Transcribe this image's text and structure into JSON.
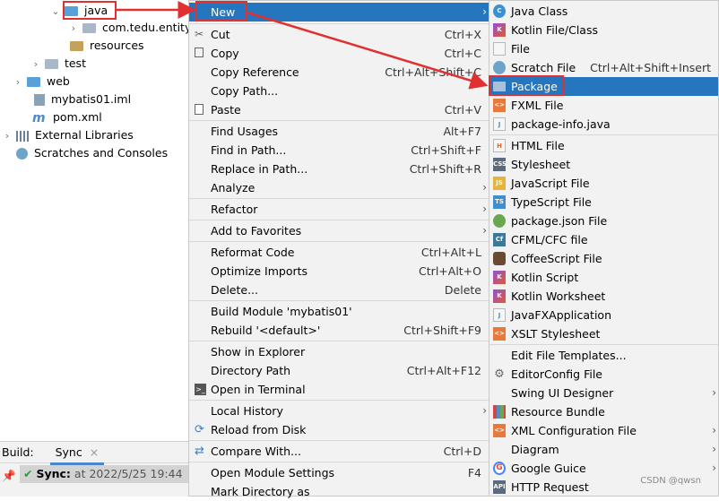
{
  "tree": {
    "java": "java",
    "entity": "com.tedu.entity",
    "resources": "resources",
    "test": "test",
    "web": "web",
    "iml": "mybatis01.iml",
    "pom": "pom.xml",
    "ext_libs": "External Libraries",
    "scratches": "Scratches and Consoles"
  },
  "bottom": {
    "build_label": "Build:",
    "sync_tab": "Sync",
    "sync_title": "Sync:",
    "sync_time": "at 2022/5/25 19:44"
  },
  "context_menu": {
    "new": "New",
    "cut": "Cut",
    "cut_sc": "Ctrl+X",
    "copy": "Copy",
    "copy_sc": "Ctrl+C",
    "copy_ref": "Copy Reference",
    "copy_ref_sc": "Ctrl+Alt+Shift+C",
    "copy_path": "Copy Path...",
    "paste": "Paste",
    "paste_sc": "Ctrl+V",
    "find_usages": "Find Usages",
    "find_usages_sc": "Alt+F7",
    "find_in_path": "Find in Path...",
    "find_in_path_sc": "Ctrl+Shift+F",
    "replace_in_path": "Replace in Path...",
    "replace_in_path_sc": "Ctrl+Shift+R",
    "analyze": "Analyze",
    "refactor": "Refactor",
    "add_favorites": "Add to Favorites",
    "reformat": "Reformat Code",
    "reformat_sc": "Ctrl+Alt+L",
    "optimize": "Optimize Imports",
    "optimize_sc": "Ctrl+Alt+O",
    "delete": "Delete...",
    "delete_sc": "Delete",
    "build_module": "Build Module 'mybatis01'",
    "rebuild": "Rebuild '<default>'",
    "rebuild_sc": "Ctrl+Shift+F9",
    "show_explorer": "Show in Explorer",
    "dir_path": "Directory Path",
    "dir_path_sc": "Ctrl+Alt+F12",
    "open_terminal": "Open in Terminal",
    "local_history": "Local History",
    "reload": "Reload from Disk",
    "compare": "Compare With...",
    "compare_sc": "Ctrl+D",
    "module_settings": "Open Module Settings",
    "module_settings_sc": "F4",
    "mark_dir": "Mark Directory as"
  },
  "new_menu": {
    "java_class": "Java Class",
    "kotlin_file": "Kotlin File/Class",
    "file": "File",
    "scratch": "Scratch File",
    "scratch_sc": "Ctrl+Alt+Shift+Insert",
    "package": "Package",
    "fxml": "FXML File",
    "pkg_info": "package-info.java",
    "html": "HTML File",
    "stylesheet": "Stylesheet",
    "js": "JavaScript File",
    "ts": "TypeScript File",
    "pkg_json": "package.json File",
    "cfml": "CFML/CFC file",
    "coffee": "CoffeeScript File",
    "kotlin_script": "Kotlin Script",
    "kotlin_ws": "Kotlin Worksheet",
    "javafx": "JavaFXApplication",
    "xslt": "XSLT Stylesheet",
    "templates": "Edit File Templates...",
    "editorconfig": "EditorConfig File",
    "swing": "Swing UI Designer",
    "resource_bundle": "Resource Bundle",
    "xml_config": "XML Configuration File",
    "diagram": "Diagram",
    "guice": "Google Guice",
    "http": "HTTP Request"
  },
  "watermark": "CSDN @qwsn",
  "colors": {
    "highlight": "#2675bf",
    "annotation": "#e03030"
  }
}
